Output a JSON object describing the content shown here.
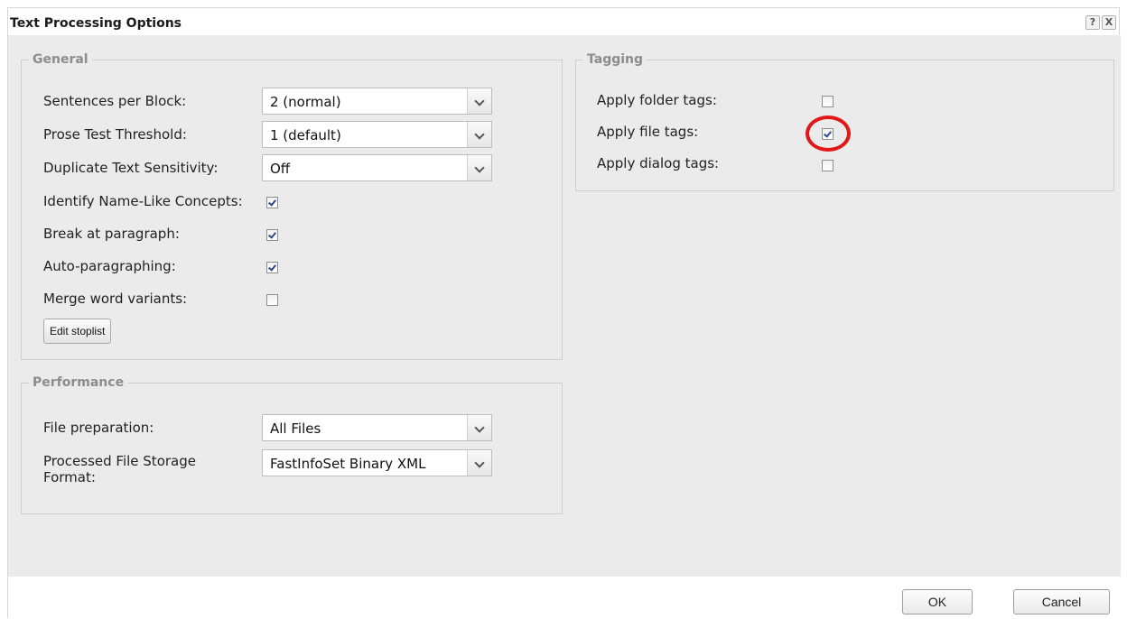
{
  "dialog": {
    "title": "Text Processing Options",
    "help_label": "?",
    "close_label": "X"
  },
  "general": {
    "legend": "General",
    "sentences_per_block": {
      "label": "Sentences per Block:",
      "value": "2 (normal)"
    },
    "prose_test_threshold": {
      "label": "Prose Test Threshold:",
      "value": "1 (default)"
    },
    "duplicate_text_sensitivity": {
      "label": "Duplicate Text Sensitivity:",
      "value": "Off"
    },
    "identify_name_like": {
      "label": "Identify Name-Like Concepts:",
      "checked": true
    },
    "break_at_paragraph": {
      "label": "Break at paragraph:",
      "checked": true
    },
    "auto_paragraphing": {
      "label": "Auto-paragraphing:",
      "checked": true
    },
    "merge_word_variants": {
      "label": "Merge word variants:",
      "checked": false
    },
    "edit_stoplist_label": "Edit stoplist"
  },
  "performance": {
    "legend": "Performance",
    "file_preparation": {
      "label": "File preparation:",
      "value": "All Files"
    },
    "storage_format": {
      "label": "Processed File Storage Format:",
      "value": "FastInfoSet Binary XML"
    }
  },
  "tagging": {
    "legend": "Tagging",
    "apply_folder_tags": {
      "label": "Apply folder tags:",
      "checked": false
    },
    "apply_file_tags": {
      "label": "Apply file tags:",
      "checked": true
    },
    "apply_dialog_tags": {
      "label": "Apply dialog tags:",
      "checked": false
    }
  },
  "footer": {
    "ok_label": "OK",
    "cancel_label": "Cancel"
  },
  "colors": {
    "panel_bg": "#ebebeb",
    "highlight": "#e01818",
    "legend_text": "#8c8c8c"
  }
}
